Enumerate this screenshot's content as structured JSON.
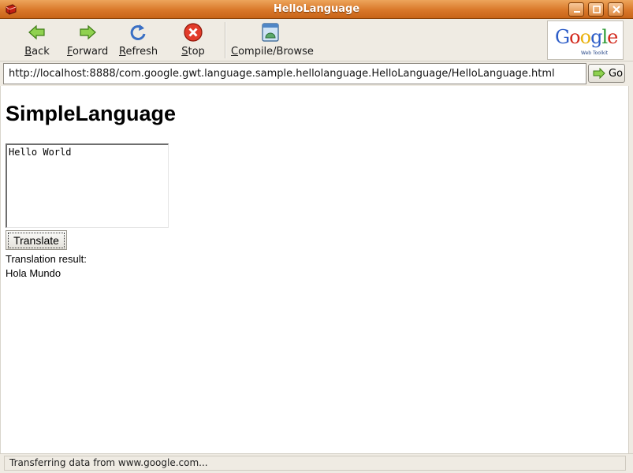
{
  "window": {
    "title": "HelloLanguage"
  },
  "toolbar": {
    "back": {
      "key": "B",
      "rest": "ack"
    },
    "forward": {
      "key": "F",
      "rest": "orward"
    },
    "refresh": {
      "key": "R",
      "rest": "efresh"
    },
    "stop": {
      "key": "S",
      "rest": "top"
    },
    "compile": {
      "key": "C",
      "rest": "ompile/Browse"
    },
    "logo": {
      "brand": "Google",
      "sub": "Web Toolkit"
    }
  },
  "address": {
    "url": "http://localhost:8888/com.google.gwt.language.sample.hellolanguage.HelloLanguage/HelloLanguage.html",
    "go_label": "Go"
  },
  "page": {
    "heading": "SimpleLanguage",
    "source_text": "Hello World",
    "translate_label": "Translate",
    "result_label": "Translation result:",
    "result_value": "Hola Mundo"
  },
  "status": {
    "text": "Transferring data from www.google.com..."
  },
  "colors": {
    "titlebar": "#d9782a",
    "chrome": "#efebe3",
    "google_blue": "#2e5ec8",
    "google_red": "#d2281c",
    "google_yellow": "#e9b20e",
    "google_green": "#2d9a36"
  }
}
